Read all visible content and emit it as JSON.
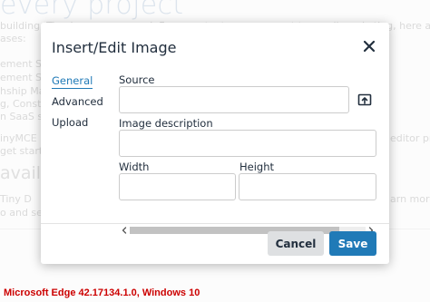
{
  "background_page": {
    "heading": "every project",
    "lines": [
      "building, Tiny has you covered. From content management to email marketing, here are",
      "ases:",
      "ement Syste",
      "ement Syste",
      "hship Mar",
      "g, Construct",
      "n SaaS sys",
      "inyMCE i",
      "get starte",
      "available",
      "Tiny D",
      "o and set",
      "editor pr",
      "arn more"
    ]
  },
  "dialog": {
    "title": "Insert/Edit Image",
    "close_icon": "close-icon",
    "nav": {
      "items": [
        {
          "label": "General",
          "active": true
        },
        {
          "label": "Advanced",
          "active": false
        },
        {
          "label": "Upload",
          "active": false
        }
      ]
    },
    "form": {
      "source_label": "Source",
      "source_value": "",
      "browse_icon": "browse-upload-icon",
      "description_label": "Image description",
      "description_value": "",
      "width_label": "Width",
      "width_value": "",
      "height_label": "Height",
      "height_value": ""
    },
    "scrollbar": {
      "position_fraction": 0.0,
      "visible_fraction": 0.89
    },
    "footer": {
      "cancel_label": "Cancel",
      "save_label": "Save"
    },
    "colors": {
      "accent": "#207ab7",
      "title_text": "#222f3e",
      "cancel_bg": "#dee0e2"
    }
  },
  "caption": "Microsoft Edge 42.17134.1.0, Windows 10"
}
